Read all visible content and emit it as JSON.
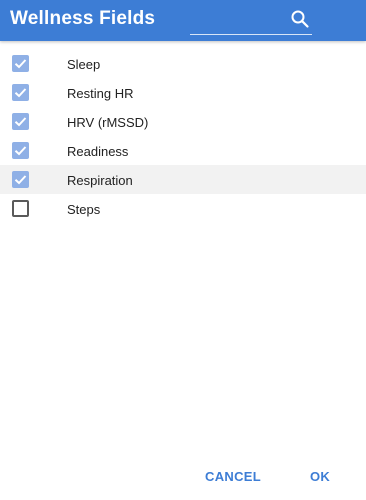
{
  "colors": {
    "header_bg": "#3d7dd5",
    "checkbox_checked": "#8fb0e6",
    "button_text": "#3d7dd5",
    "highlight_row": "#f2f2f2"
  },
  "header": {
    "title": "Wellness Fields",
    "search": {
      "value": "",
      "placeholder": "",
      "icon": "search-icon"
    }
  },
  "fields": [
    {
      "label": "Sleep",
      "checked": true
    },
    {
      "label": "Resting HR",
      "checked": true
    },
    {
      "label": "HRV (rMSSD)",
      "checked": true
    },
    {
      "label": "Readiness",
      "checked": true
    },
    {
      "label": "Respiration",
      "checked": true,
      "highlighted": true
    },
    {
      "label": "Steps",
      "checked": false
    }
  ],
  "footer": {
    "cancel_label": "CANCEL",
    "ok_label": "OK"
  }
}
